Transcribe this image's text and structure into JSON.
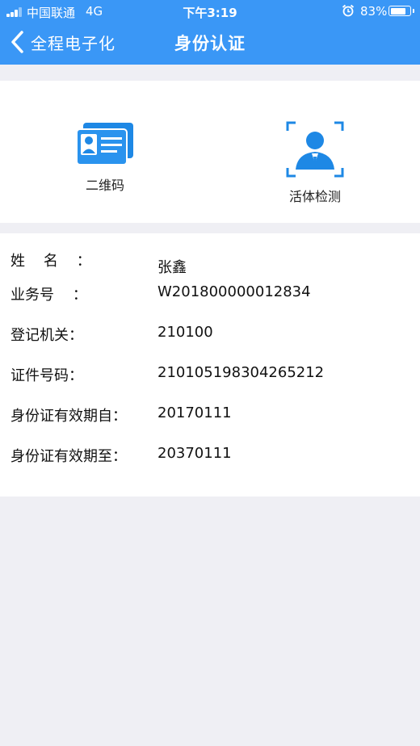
{
  "status_bar": {
    "carrier": "中国联通",
    "network": "4G",
    "time": "下午3:19",
    "battery": "83%",
    "battery_level": 0.83
  },
  "nav": {
    "back_label": "全程电子化",
    "title": "身份认证"
  },
  "auth_options": {
    "qr": {
      "label": "二维码",
      "icon": "id-card-icon"
    },
    "live": {
      "label": "活体检测",
      "icon": "face-scan-icon"
    }
  },
  "info": [
    {
      "label": "姓    名    ：",
      "value": "张鑫"
    },
    {
      "label": "业务号    ：",
      "value": "W201800000012834"
    },
    {
      "label": "登记机关：",
      "value": "210100"
    },
    {
      "label": "证件号码：",
      "value": "210105198304265212"
    },
    {
      "label": "身份证有效期自：",
      "value": "20170111"
    },
    {
      "label": "身份证有效期至：",
      "value": "20370111"
    }
  ],
  "colors": {
    "accent": "#3a97f6",
    "page_bg": "#efeff4",
    "icon_blue": "#1e88e5"
  }
}
